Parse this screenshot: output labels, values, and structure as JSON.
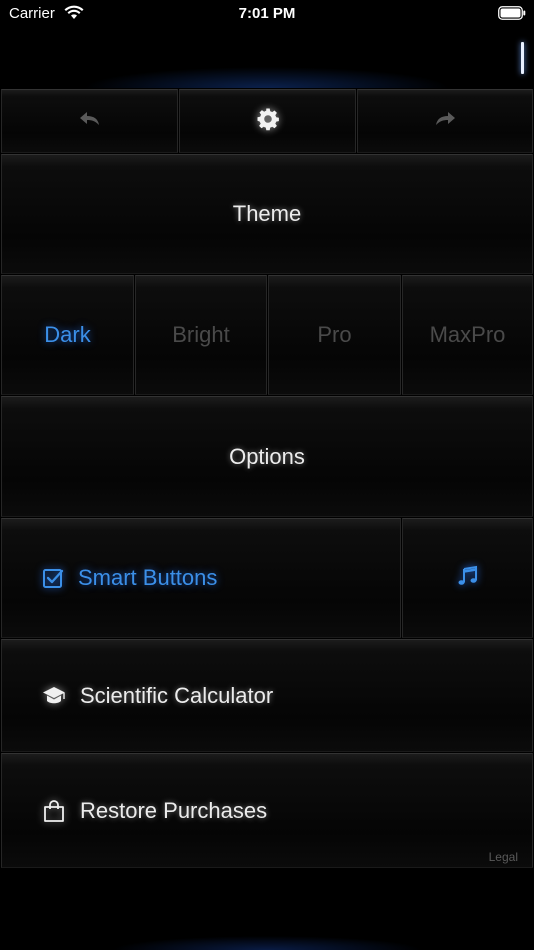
{
  "status_bar": {
    "carrier": "Carrier",
    "time": "7:01 PM"
  },
  "toolbar": {
    "undo_icon": "undo-arrow-icon",
    "settings_icon": "gear-icon",
    "redo_icon": "redo-arrow-icon"
  },
  "theme": {
    "title": "Theme",
    "options": [
      {
        "label": "Dark",
        "selected": true
      },
      {
        "label": "Bright",
        "selected": false
      },
      {
        "label": "Pro",
        "selected": false
      },
      {
        "label": "MaxPro",
        "selected": false
      }
    ]
  },
  "options": {
    "title": "Options",
    "smart_buttons": {
      "label": "Smart Buttons",
      "checked": true,
      "icon": "checkbox-checked-icon"
    },
    "sound_icon": "music-note-icon",
    "scientific": {
      "label": "Scientific Calculator",
      "icon": "graduation-cap-icon"
    },
    "restore": {
      "label": "Restore Purchases",
      "icon": "shopping-bag-icon"
    },
    "legal": "Legal"
  },
  "colors": {
    "accent": "#3b8fe8",
    "background": "#000000",
    "dim_text": "#4a4a4a"
  }
}
